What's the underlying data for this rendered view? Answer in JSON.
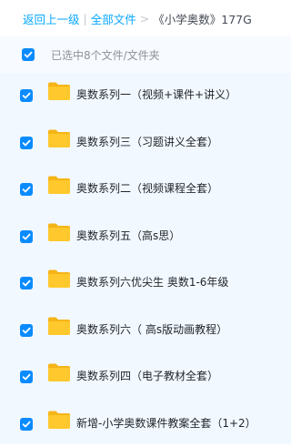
{
  "breadcrumb": {
    "back": "返回上一级",
    "divider": "|",
    "all_files": "全部文件",
    "arrow": ">",
    "current": "《小学奥数》177G"
  },
  "selection": {
    "label": "已选中8个文件/文件夹",
    "checked": true
  },
  "colors": {
    "accent": "#06a7ff",
    "checkbox": "#0a8bff",
    "folder": "#ffc82c",
    "panel_bg": "#f2f8ff"
  },
  "files": [
    {
      "name": "奥数系列一（视频+课件+讲义）",
      "icon": "folder-icon",
      "checked": true
    },
    {
      "name": "奥数系列三（习题讲义全套）",
      "icon": "folder-icon",
      "checked": true
    },
    {
      "name": "奥数系列二（视频课程全套）",
      "icon": "folder-icon",
      "checked": true
    },
    {
      "name": "奥数系列五（高s思）",
      "icon": "folder-icon",
      "checked": true
    },
    {
      "name": "奥数系列六优尖生 奥数1-6年级",
      "icon": "folder-icon",
      "checked": true
    },
    {
      "name": "奥数系列六（ 高s版动画教程）",
      "icon": "folder-icon",
      "checked": true
    },
    {
      "name": "奥数系列四（电子教材全套）",
      "icon": "folder-icon",
      "checked": true
    },
    {
      "name": "新增-小学奥数课件教案全套（1+2）",
      "icon": "folder-icon",
      "checked": true
    }
  ]
}
